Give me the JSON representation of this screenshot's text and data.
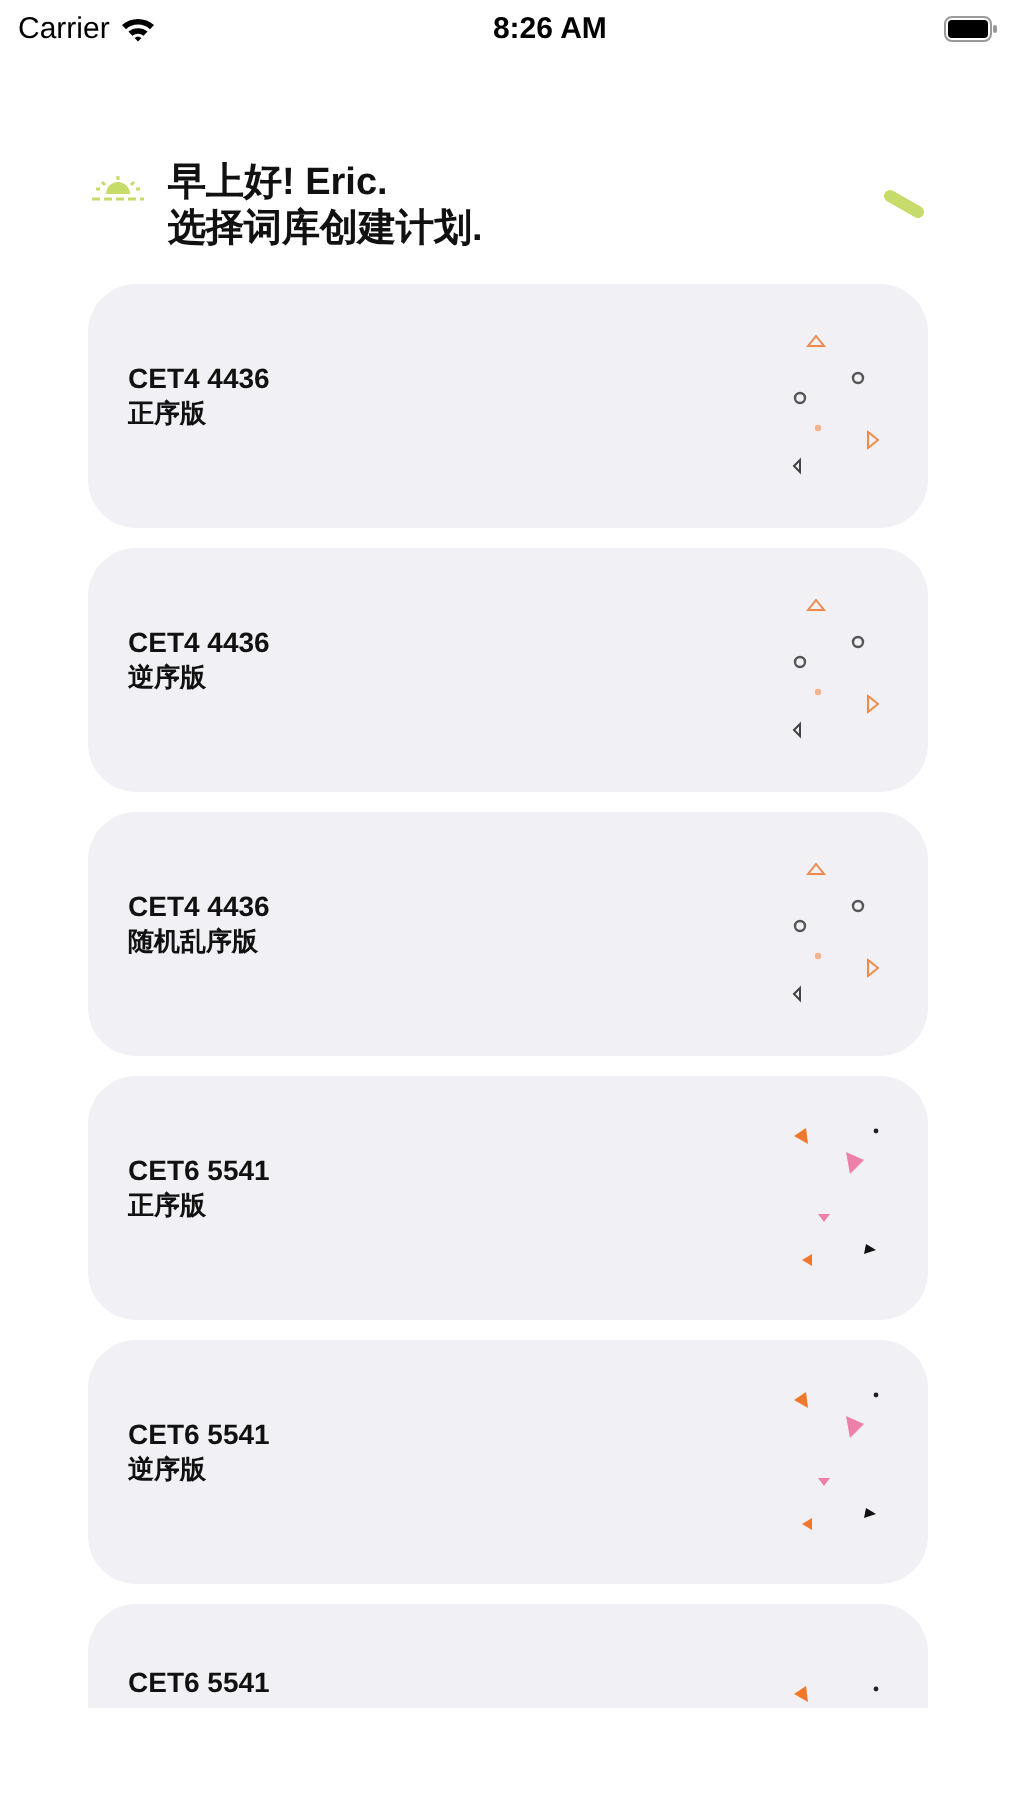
{
  "status_bar": {
    "carrier": "Carrier",
    "time": "8:26 AM"
  },
  "header": {
    "greeting": "早上好! Eric.",
    "prompt": "选择词库创建计划."
  },
  "plans": [
    {
      "title": "CET4 4436",
      "subtitle": "正序版",
      "kind": "outline"
    },
    {
      "title": "CET4 4436",
      "subtitle": "逆序版",
      "kind": "outline"
    },
    {
      "title": "CET4 4436",
      "subtitle": "随机乱序版",
      "kind": "outline"
    },
    {
      "title": "CET6 5541",
      "subtitle": "正序版",
      "kind": "filled"
    },
    {
      "title": "CET6 5541",
      "subtitle": "逆序版",
      "kind": "filled"
    },
    {
      "title": "CET6 5541",
      "kind": "filled"
    }
  ]
}
